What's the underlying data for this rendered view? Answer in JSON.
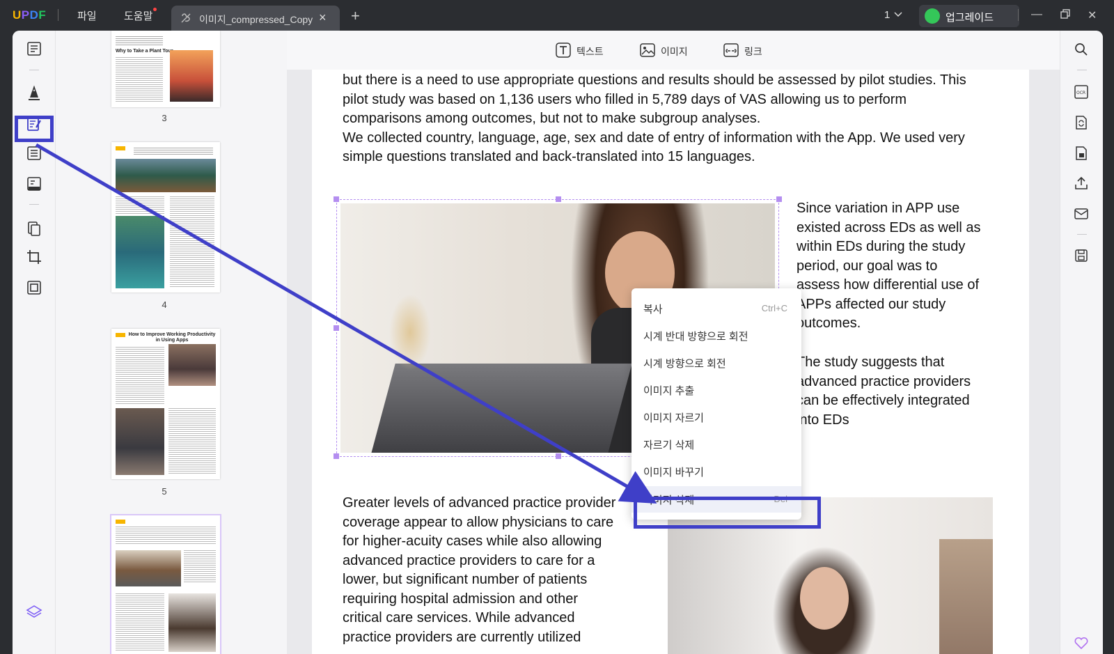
{
  "app": {
    "logo": "UPDF"
  },
  "titlebar": {
    "menus": [
      {
        "label": "파일"
      },
      {
        "label": "도움말"
      }
    ],
    "tab_title": "이미지_compressed_Copy",
    "page_number": "1",
    "upgrade_label": "업그레이드"
  },
  "toolbar": {
    "text_label": "텍스트",
    "image_label": "이미지",
    "link_label": "링크"
  },
  "thumbnails": {
    "page_labels": [
      "3",
      "4",
      "5"
    ],
    "page3_heading": "Why to Take a Plant Tour",
    "page5_heading": "How to Improve Working Productivity in Using Apps"
  },
  "document": {
    "para1": [
      "but there is a need to use appropriate questions and results should be assessed by pilot studies. This",
      "pilot study was based on 1,136 users who filled in 5,789 days of VAS allowing us to perform",
      "comparisons among outcomes, but not to make subgroup analyses.",
      "We collected country, language, age, sex and date of entry of information with the App. We used very",
      "simple questions translated and back-translated into 15 languages."
    ],
    "para2": [
      "Since variation in APP use",
      "existed across EDs as well as",
      "within EDs during the study",
      "period, our goal was to",
      "assess how differential use of",
      "APPs affected our study",
      "outcomes."
    ],
    "para3": [
      "The study suggests that",
      "advanced practice providers",
      "can be effectively integrated",
      "into EDs"
    ],
    "para4": [
      "Greater levels of advanced practice provider",
      "coverage appear to allow physicians to care",
      "for higher-acuity cases while also allowing",
      "advanced practice providers to care for a",
      "lower, but significant number of patients",
      "requiring hospital admission and other",
      "critical care services. While advanced",
      "practice providers are currently utilized"
    ]
  },
  "context_menu": {
    "items": [
      {
        "label": "복사",
        "shortcut": "Ctrl+C"
      },
      {
        "label": "시계 반대 방향으로 회전",
        "shortcut": ""
      },
      {
        "label": "시계 방향으로 회전",
        "shortcut": ""
      },
      {
        "label": "이미지 추출",
        "shortcut": ""
      },
      {
        "label": "이미지 자르기",
        "shortcut": ""
      },
      {
        "label": "자르기 삭제",
        "shortcut": ""
      },
      {
        "label": "이미지 바꾸기",
        "shortcut": ""
      },
      {
        "label": "이미지 삭제",
        "shortcut": "Del"
      }
    ]
  },
  "annotation_color": "#3f3fc8",
  "accent_color": "#b48ef0"
}
